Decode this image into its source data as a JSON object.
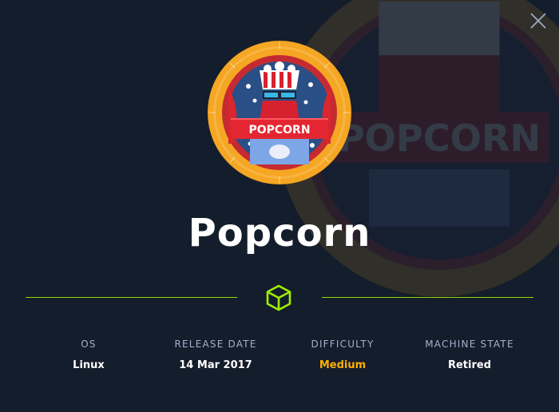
{
  "machine": {
    "name": "Popcorn",
    "logo_text": "POPCORN"
  },
  "icons": {
    "close": "close-icon",
    "divider": "cube-icon"
  },
  "stats": [
    {
      "label": "OS",
      "value": "Linux"
    },
    {
      "label": "RELEASE DATE",
      "value": "14 Mar 2017"
    },
    {
      "label": "DIFFICULTY",
      "value": "Medium"
    },
    {
      "label": "MACHINE STATE",
      "value": "Retired"
    }
  ],
  "colors": {
    "background": "#141d2b",
    "accent_green": "#9fef00",
    "label_gray": "#a4b1cd",
    "difficulty_medium": "#ffaf00",
    "badge_ring": "#f5a623",
    "logo_red": "#d6222f"
  }
}
